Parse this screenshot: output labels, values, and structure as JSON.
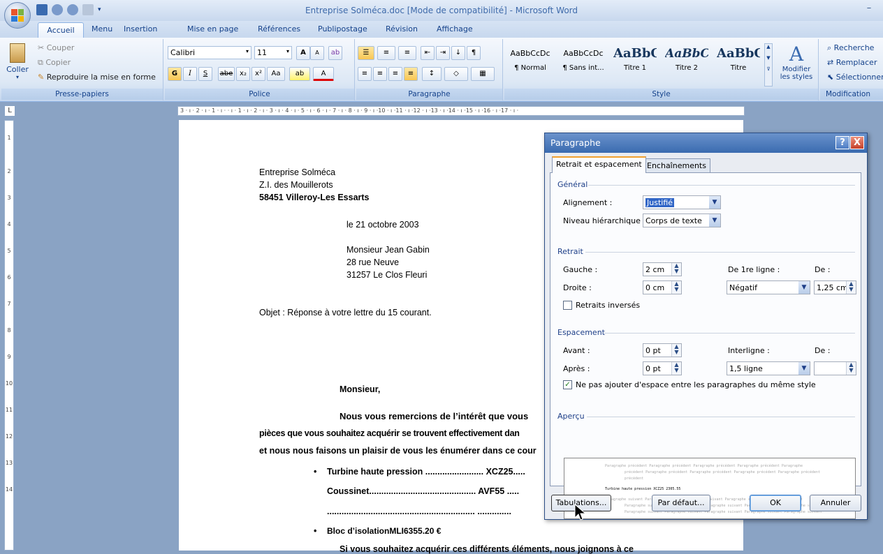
{
  "titlebar": {
    "title": "Entreprise Solméca.doc [Mode de compatibilité] - Microsoft Word",
    "min": "–"
  },
  "tabs": [
    "Accueil",
    "Menu",
    "Insertion",
    "Mise en page",
    "Références",
    "Publipostage",
    "Révision",
    "Affichage"
  ],
  "ribbon": {
    "clipboard": {
      "paste": "Coller",
      "cut": "Couper",
      "copy": "Copier",
      "format_painter": "Reproduire la mise en forme",
      "label": "Presse-papiers"
    },
    "font": {
      "family": "Calibri",
      "size": "11",
      "bold": "G",
      "italic": "I",
      "underline": "S",
      "strike": "abe",
      "sub": "x₂",
      "sup": "x²",
      "case": "Aa",
      "grow": "A",
      "shrink": "A",
      "label": "Police"
    },
    "paragraph": {
      "label": "Paragraphe"
    },
    "style": {
      "label": "Style",
      "items": [
        {
          "preview": "AaBbCcDc",
          "name": "¶ Normal"
        },
        {
          "preview": "AaBbCcDc",
          "name": "¶ Sans int..."
        },
        {
          "preview": "AaBbC",
          "name": "Titre 1"
        },
        {
          "preview": "AaBbCc",
          "name": "Titre 2"
        },
        {
          "preview": "AaBbC",
          "name": "Titre"
        }
      ],
      "modify": "Modifier les styles"
    },
    "editing": {
      "find": "Recherche",
      "replace": "Remplacer",
      "select": "Sélectionner",
      "label": "Modification"
    }
  },
  "ruler": {
    "corner": "L",
    "hticks": "3 · ı · 2 · ı · 1 · ı ·   · ı · 1 · ı · 2 · ı · 3 · ı · 4 · ı · 5 · ı · 6 · ı · 7 · ı · 8 · ı · 9 · ı ·10 · ı ·11 · ı ·12 · ı ·13 · ı ·14 · ı ·15 · ı ·16 · ı ·17 · ı ·",
    "vticks": [
      "1",
      "2",
      "3",
      "4",
      "5",
      "6",
      "7",
      "8",
      "9",
      "10",
      "11",
      "12",
      "13",
      "14"
    ]
  },
  "document": {
    "sender": [
      "Entreprise Solméca",
      "Z.I. des Mouillerots",
      "58451 Villeroy-Les Essarts"
    ],
    "date": "le 21 octobre 2003",
    "recipient": [
      "Monsieur Jean Gabin",
      "28 rue Neuve",
      "31257  Le Clos Fleuri"
    ],
    "object": "Objet : Réponse à votre lettre du 15 courant.",
    "salutation": "Monsieur,",
    "body1": "Nous vous remercions de l’intérêt que vous",
    "body2": "pièces que vous souhaitez acquérir se trouvent effectivement dan",
    "body3": "et nous nous faisons un plaisir de vous les énumérer dans ce cour",
    "item1": "Turbine haute pression ........................ XCZ25.....",
    "item2": "Coussinet............................................ AVF55 .....",
    "item3": "............................................................. ..............",
    "item4": "Bloc d’isolationMLI6355.20 €",
    "body4": "Si vous souhaitez acquérir ces différents éléments, nous joignons à ce"
  },
  "dialog": {
    "title": "Paragraphe",
    "help": "?",
    "close": "X",
    "tab1": "Retrait et espacement",
    "tab2": "Enchaînements",
    "general": "Général",
    "alignment_label": "Alignement :",
    "alignment": "Justifié",
    "level_label": "Niveau hiérarchique :",
    "level": "Corps de texte",
    "indent": "Retrait",
    "left_label": "Gauche :",
    "left": "2 cm",
    "right_label": "Droite :",
    "right": "0 cm",
    "first_label": "De 1re ligne :",
    "first": "Négatif",
    "by_label": "De :",
    "by": "1,25 cm",
    "mirror": "Retraits inversés",
    "spacing": "Espacement",
    "before_label": "Avant :",
    "before": "0 pt",
    "after_label": "Après :",
    "after": "0 pt",
    "line_label": "Interligne :",
    "line": "1,5 ligne",
    "at_label": "De :",
    "at": "",
    "no_space": "Ne pas ajouter d'espace entre les paragraphes du même style",
    "preview": "Aperçu",
    "pv_prev": "Paragraphe précédent Paragraphe précédent Paragraphe précédent Paragraphe précédent Paragraphe",
    "pv_prev2": "précédent Paragraphe précédent Paragraphe précédent Paragraphe précédent Paragraphe précédent",
    "pv_prev3": "précédent",
    "pv_sample": "Turbine haute pression         XCZ25     2305.55",
    "pv_next": "Paragraphe suivant Paragraphe suivant Paragraphe suivant Paragraphe suivant Paragraphe suivant",
    "pv_next2": "Paragraphe suivant Paragraphe suivant Paragraphe suivant Paragraphe suivant Paragraphe suivant",
    "tabs_btn": "Tabulations...",
    "default_btn": "Par défaut...",
    "ok": "OK",
    "cancel": "Annuler"
  }
}
